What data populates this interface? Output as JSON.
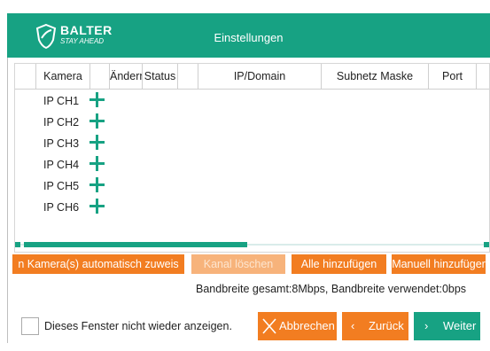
{
  "header": {
    "brand": "BALTER",
    "slogan": "STAY AHEAD",
    "title": "Einstellungen"
  },
  "table": {
    "columns": [
      "Kamera",
      "Ändern",
      "Status",
      "IP/Domain",
      "Subnetz Maske",
      "Port"
    ],
    "rows": [
      "IP CH1",
      "IP CH2",
      "IP CH3",
      "IP CH4",
      "IP CH5",
      "IP CH6"
    ]
  },
  "actions": {
    "auto_assign": "n Kamera(s) automatisch zuweis",
    "delete_channel": "Kanal löschen",
    "add_all": "Alle hinzufügen",
    "add_manual": "Manuell hinzufüger"
  },
  "bandwidth": "Bandbreite gesamt:8Mbps, Bandbreite verwendet:0bps",
  "footer": {
    "dont_show": "Dieses Fenster nicht wieder anzeigen.",
    "cancel": "Abbrechen",
    "back": "Zurück",
    "next": "Weiter"
  },
  "colors": {
    "accent": "#17a283",
    "orange": "#f27d21"
  }
}
